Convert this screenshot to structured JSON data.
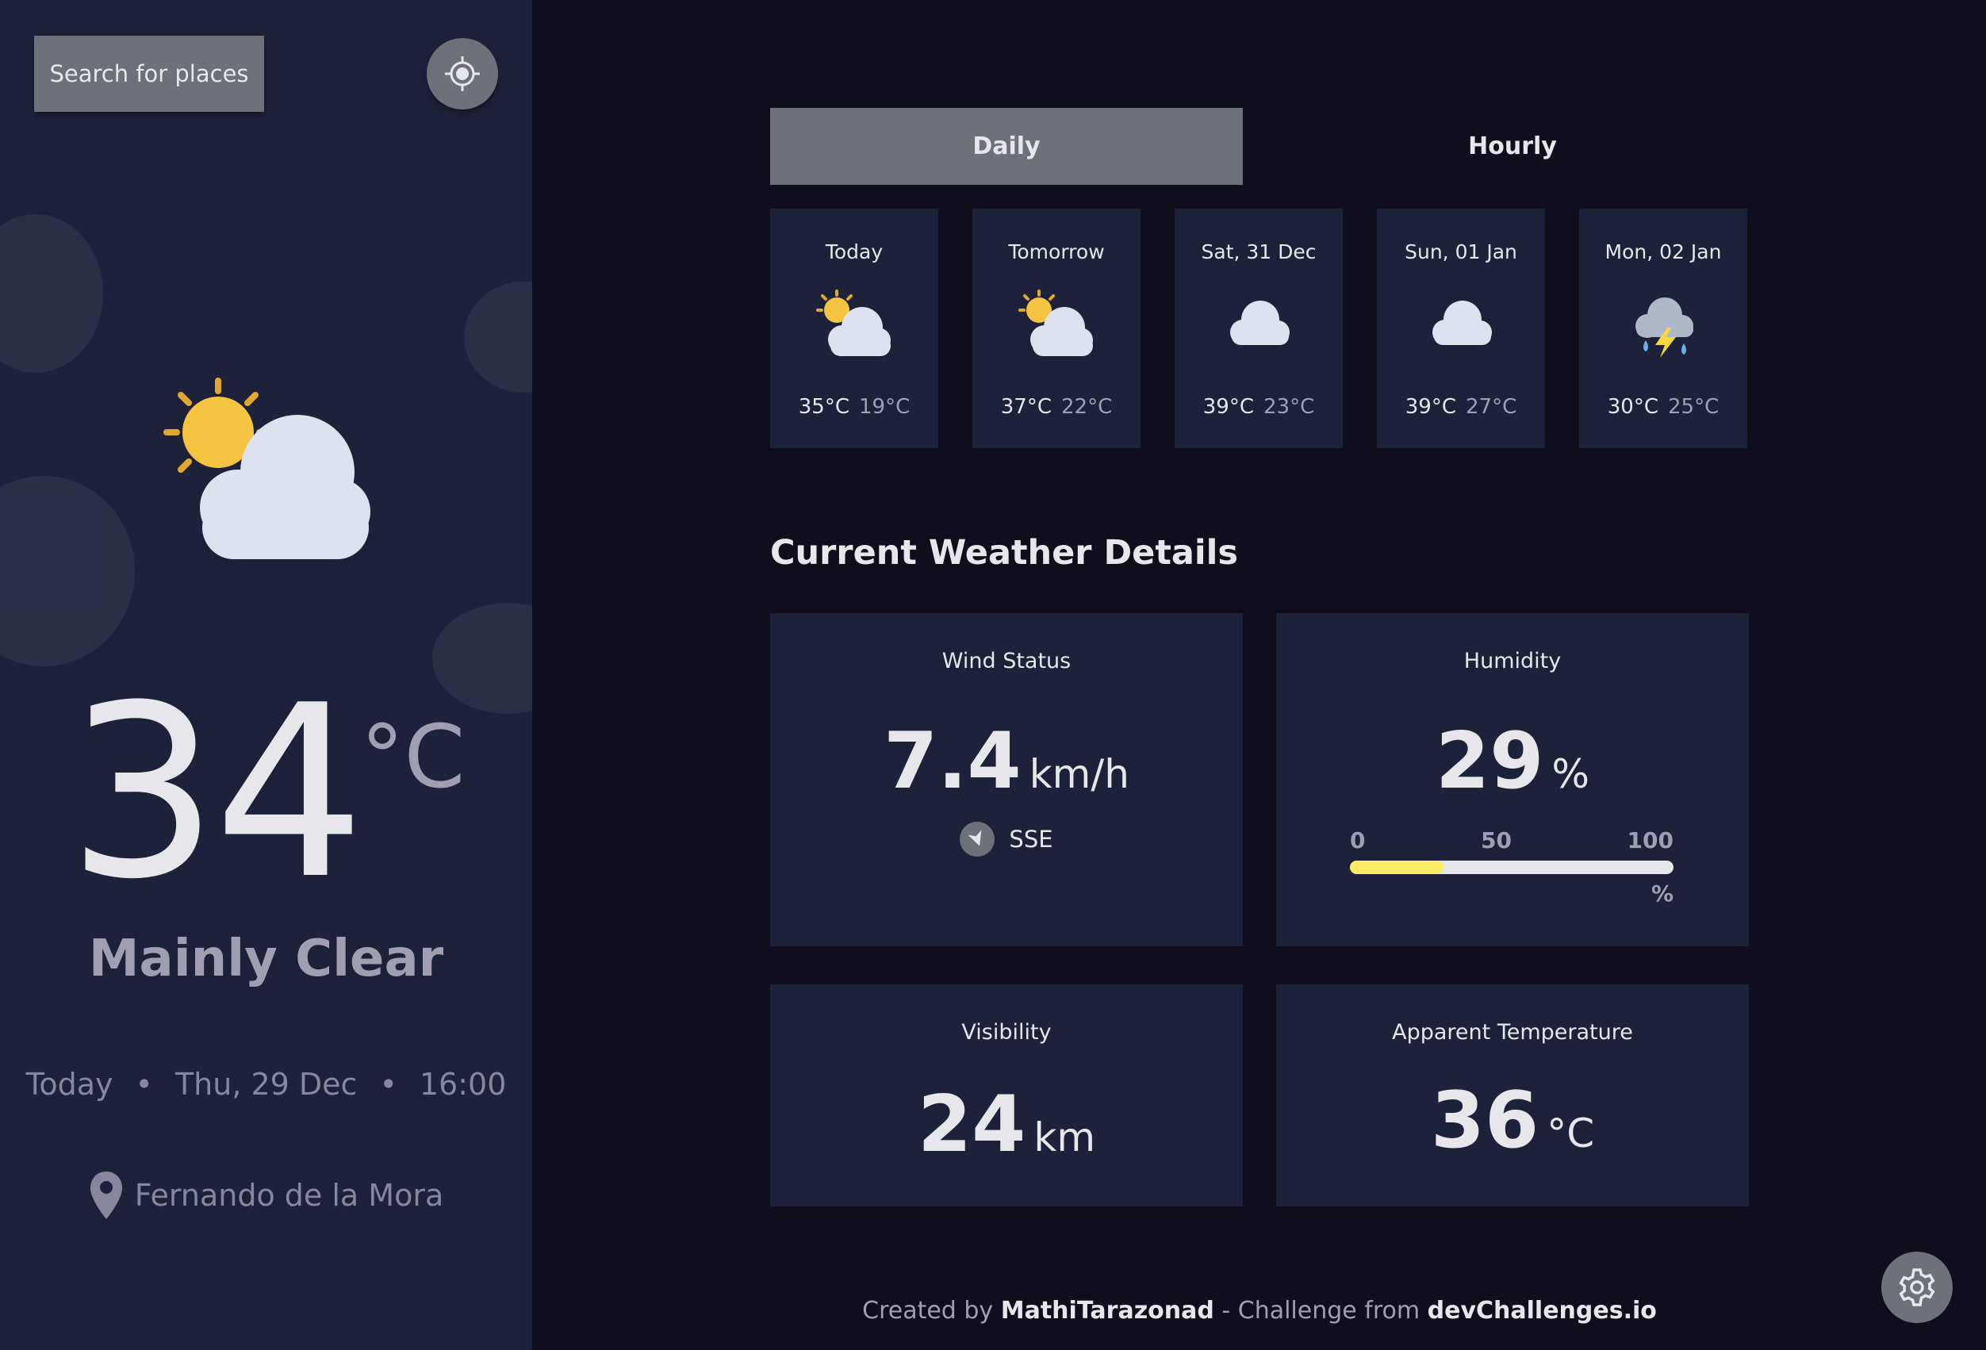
{
  "sidebar": {
    "search_label": "Search for places",
    "current": {
      "temp": "34",
      "unit": "°C",
      "condition": "Mainly Clear",
      "day": "Today",
      "date": "Thu, 29 Dec",
      "time": "16:00",
      "location": "Fernando de la Mora",
      "icon": "sun-cloud-icon"
    }
  },
  "tabs": [
    {
      "label": "Daily",
      "active": true
    },
    {
      "label": "Hourly",
      "active": false
    }
  ],
  "forecast": [
    {
      "day": "Today",
      "max": "35°C",
      "min": "19°C",
      "icon": "sun-cloud-icon"
    },
    {
      "day": "Tomorrow",
      "max": "37°C",
      "min": "22°C",
      "icon": "sun-cloud-icon"
    },
    {
      "day": "Sat, 31 Dec",
      "max": "39°C",
      "min": "23°C",
      "icon": "cloud-icon"
    },
    {
      "day": "Sun, 01 Jan",
      "max": "39°C",
      "min": "27°C",
      "icon": "cloud-icon"
    },
    {
      "day": "Mon, 02 Jan",
      "max": "30°C",
      "min": "25°C",
      "icon": "thunderstorm-icon"
    }
  ],
  "details": {
    "title": "Current Weather Details",
    "wind": {
      "label": "Wind Status",
      "value": "7.4",
      "unit": "km/h",
      "direction": "SSE"
    },
    "humidity": {
      "label": "Humidity",
      "value": "29",
      "unit": "%",
      "scale": [
        "0",
        "50",
        "100"
      ],
      "scale_unit": "%",
      "fraction": 0.29
    },
    "visibility": {
      "label": "Visibility",
      "value": "24",
      "unit": "km"
    },
    "apparent": {
      "label": "Apparent Temperature",
      "value": "36",
      "unit": "°C"
    }
  },
  "footer": {
    "created_by": "Created by",
    "author": "MathiTarazonad",
    "challenge": "- Challenge from",
    "site": "devChallenges.io"
  },
  "colors": {
    "accent": "#ffec65",
    "panel": "#1e213a",
    "background": "#100e1d"
  }
}
